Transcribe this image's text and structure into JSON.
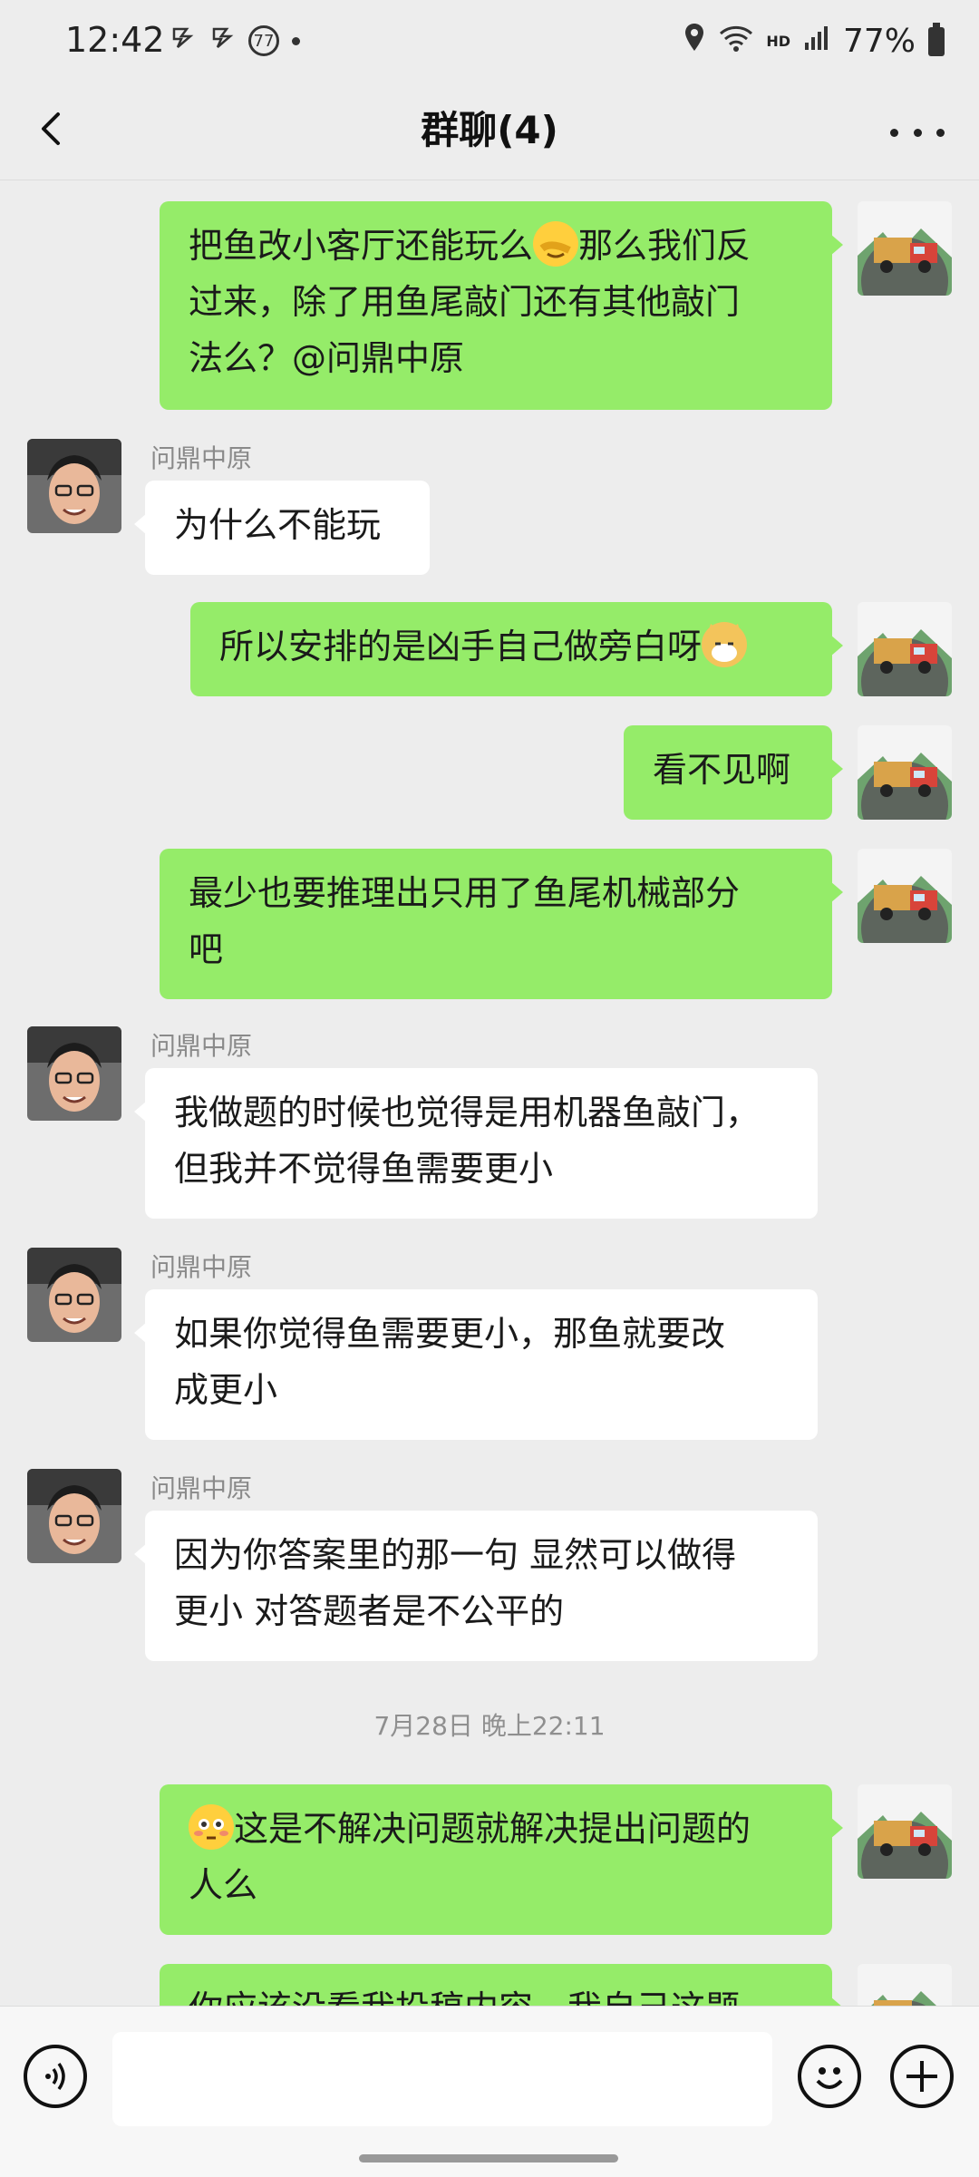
{
  "status_bar": {
    "time": "12:42",
    "notif_badge": "77",
    "hd_label": "HD",
    "battery": "77%"
  },
  "nav": {
    "title": "群聊(4)"
  },
  "sender_name": "问鼎中原",
  "messages": [
    {
      "from": "me",
      "text": "把鱼改小客厅还能玩么😭那么我们反过来，除了用鱼尾敲门还有其他敲门法么？@问鼎中原"
    },
    {
      "from": "other",
      "text": "为什么不能玩"
    },
    {
      "from": "me",
      "text": "所以安排的是凶手自己做旁白呀🐱"
    },
    {
      "from": "me",
      "text": "看不见啊"
    },
    {
      "from": "me",
      "text": "最少也要推理出只用了鱼尾机械部分吧"
    },
    {
      "from": "other",
      "text": "我做题的时候也觉得是用机器鱼敲门，但我并不觉得鱼需要更小"
    },
    {
      "from": "other",
      "text": "如果你觉得鱼需要更小，那鱼就要改成更小"
    },
    {
      "from": "other",
      "text": "因为你答案里的那一句 显然可以做得更小 对答题者是不公平的"
    },
    {
      "from": "me",
      "text": "😳这是不解决问题就解决提出问题的人么"
    },
    {
      "from": "me",
      "text": "你应该没看我投稿内容，我自己这题"
    }
  ],
  "timestamp": "7月28日 晚上22:11",
  "line_texts": {
    "m1a": "把鱼改小客厅还能玩么",
    "m1b": "那么我们反",
    "m1c": "过来，除了用鱼尾敲门还有其他敲门",
    "m1d": "法么？@问鼎中原",
    "m3": "所以安排的是凶手自己做旁白呀",
    "m5a": "最少也要推理出只用了鱼尾机械部分",
    "m5b": "吧",
    "m6a": "我做题的时候也觉得是用机器鱼敲门，",
    "m6b": "但我并不觉得鱼需要更小",
    "m7a": "如果你觉得鱼需要更小，那鱼就要改",
    "m7b": "成更小",
    "m8a": "因为你答案里的那一句 显然可以做得",
    "m8b": "更小 对答题者是不公平的",
    "m9a": "这是不解决问题就解决提出问题的",
    "m9b": "人么",
    "m10": "你应该没看我投稿内容，我自己这题"
  },
  "colors": {
    "background": "#ededed",
    "sent_bubble": "#95ec69",
    "received_bubble": "#ffffff"
  },
  "input": {
    "placeholder": ""
  },
  "icons": [
    "back-arrow-icon",
    "more-icon",
    "voice-icon",
    "emoji-icon",
    "plus-icon",
    "location-icon",
    "wifi-icon",
    "signal-icon",
    "battery-icon"
  ]
}
